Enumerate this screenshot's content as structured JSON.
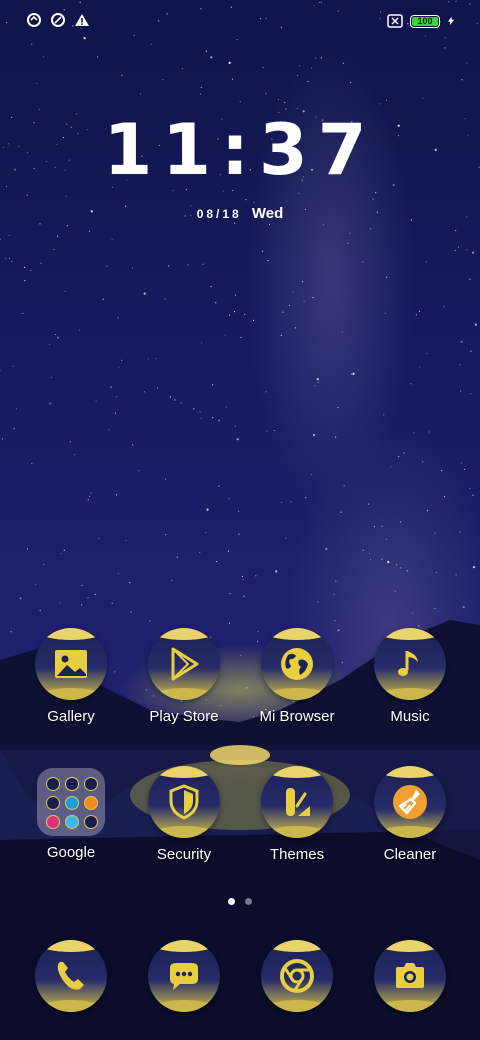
{
  "status_bar": {
    "left_icons": [
      "data-saver-icon",
      "data-saver-icon",
      "warning-icon"
    ],
    "right_icons": [
      "no-sim-icon",
      "battery-icon",
      "charging-icon"
    ],
    "battery_level": "100"
  },
  "lockscreen": {
    "time": "11:37",
    "date": "08/18",
    "weekday": "Wed"
  },
  "apps": [
    {
      "label": "Gallery",
      "icon": "image-icon"
    },
    {
      "label": "Play Store",
      "icon": "play-store-icon"
    },
    {
      "label": "Mi Browser",
      "icon": "globe-icon"
    },
    {
      "label": "Music",
      "icon": "music-note-icon"
    },
    {
      "label": "Google",
      "icon": "folder-icon"
    },
    {
      "label": "Security",
      "icon": "shield-icon"
    },
    {
      "label": "Themes",
      "icon": "themes-icon"
    },
    {
      "label": "Cleaner",
      "icon": "broom-icon"
    }
  ],
  "dock": [
    {
      "icon": "phone-icon"
    },
    {
      "icon": "messages-icon"
    },
    {
      "icon": "chrome-icon"
    },
    {
      "icon": "camera-icon"
    }
  ],
  "pager": {
    "pages": 2,
    "active": 1
  },
  "colors": {
    "icon_yellow": "#e7cf3f",
    "icon_dark": "#1e2156",
    "battery_green": "#3ed43e"
  }
}
